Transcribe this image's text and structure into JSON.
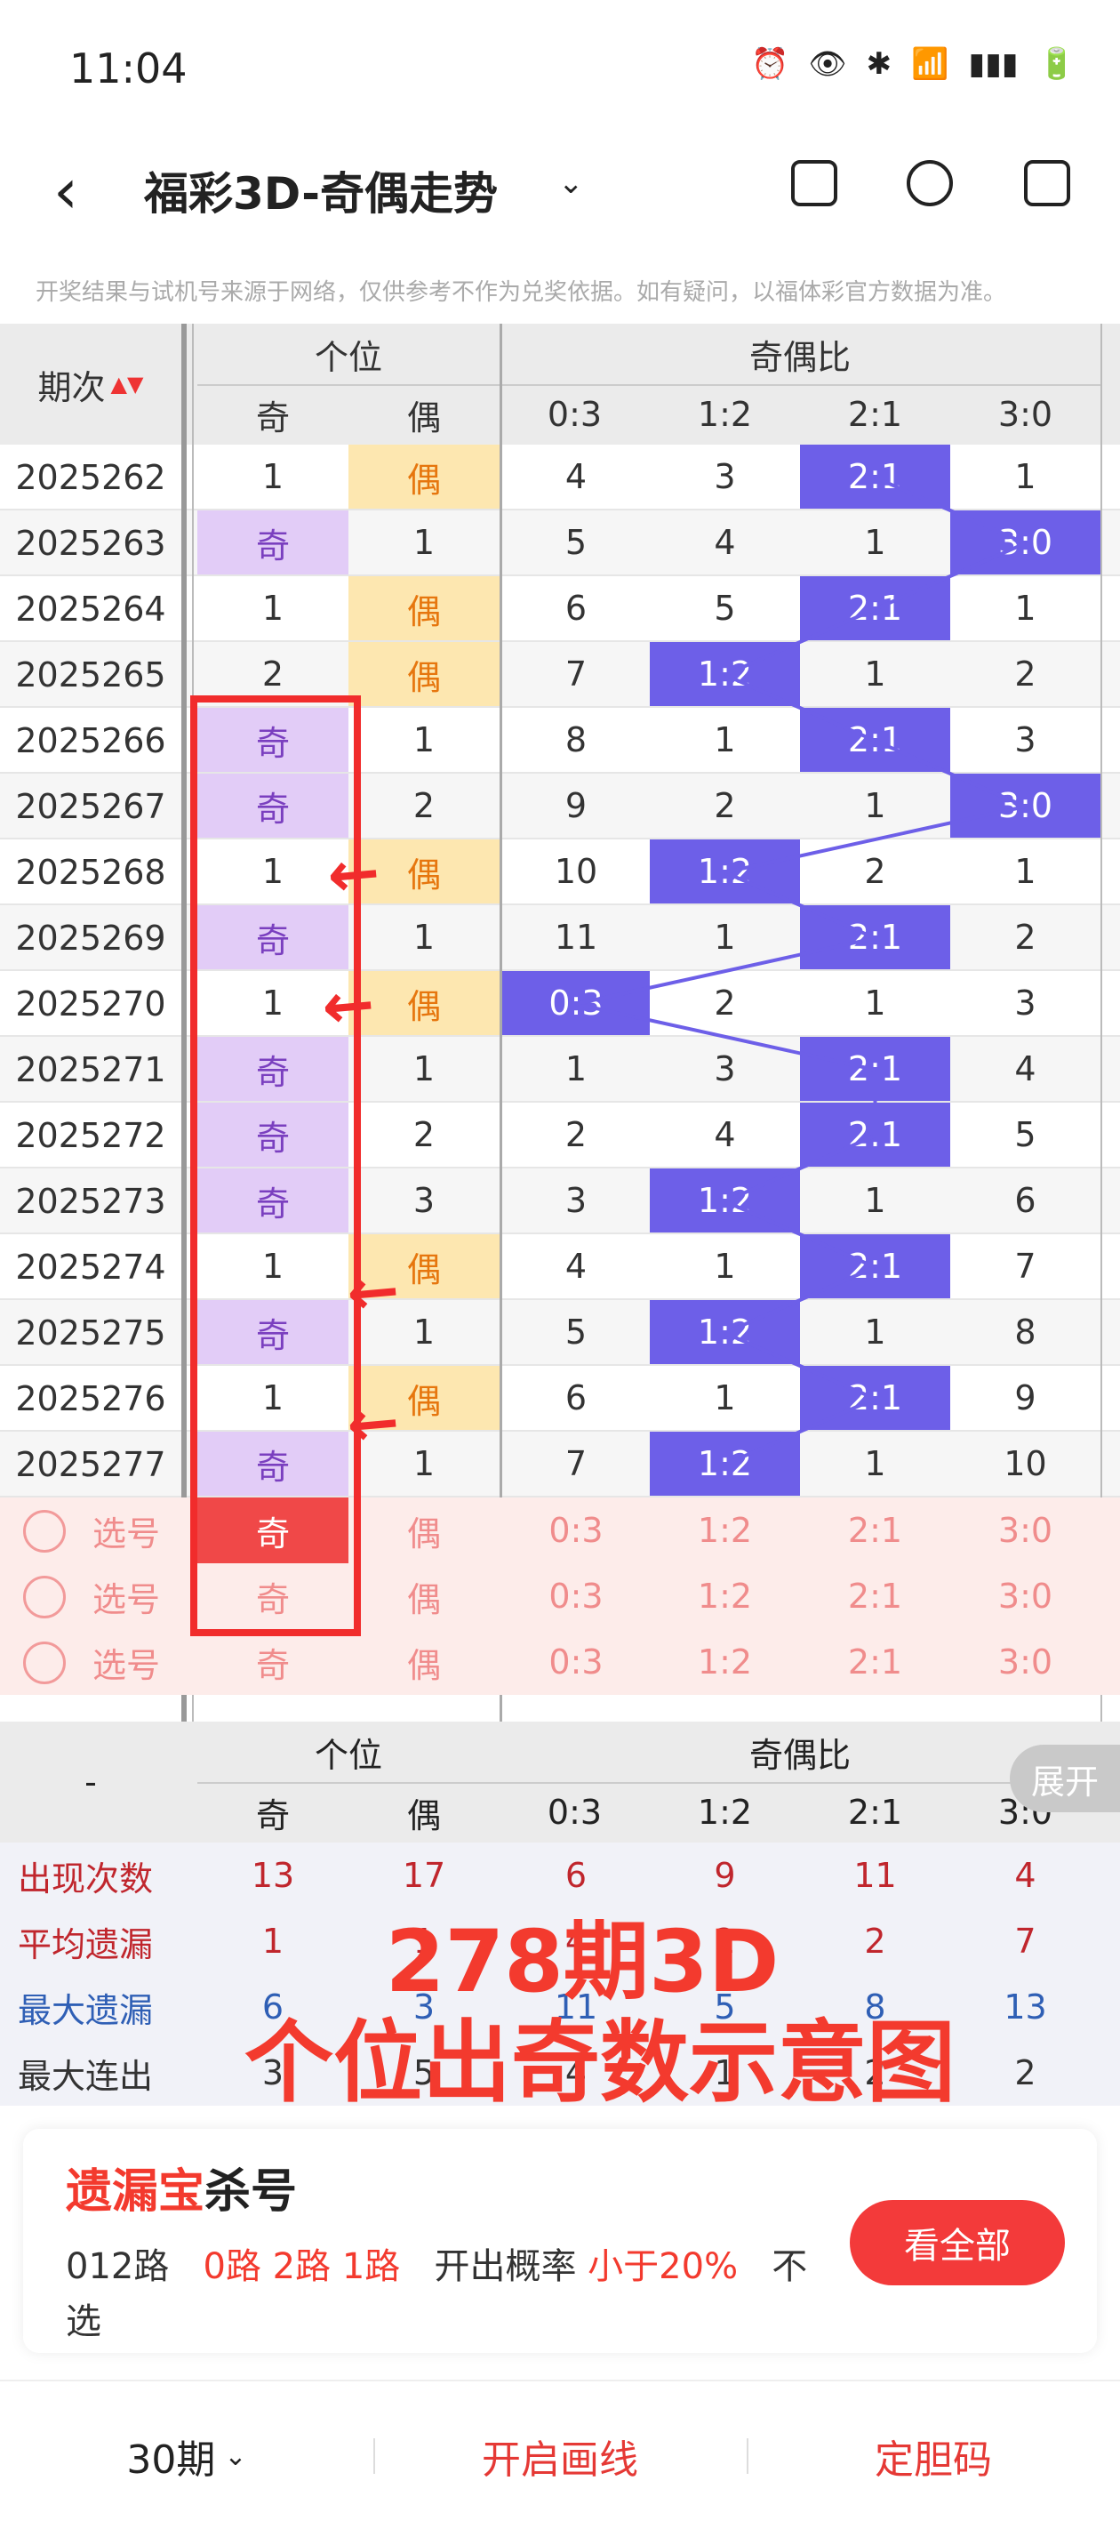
{
  "status": {
    "time": "11:04",
    "battery_icon": "battery-charging-icon"
  },
  "header": {
    "title": "福彩3D-奇偶走势"
  },
  "notice": "开奖结果与试机号来源于网络，仅供参考不作为兑奖依据。如有疑问，以福体彩官方数据为准。",
  "table": {
    "period_header": "期次",
    "group_units": "个位",
    "group_ratio": "奇偶比",
    "col_odd": "奇",
    "col_even": "偶",
    "col_03": "0:3",
    "col_12": "1:2",
    "col_21": "2:1",
    "col_30": "3:0",
    "rows": [
      {
        "period": "2025262",
        "odd": "1",
        "even": "偶",
        "r03": "4",
        "r12": "3",
        "r21": "2:1",
        "r30": "1",
        "hit": "21",
        "unit": "even"
      },
      {
        "period": "2025263",
        "odd": "奇",
        "even": "1",
        "r03": "5",
        "r12": "4",
        "r21": "1",
        "r30": "3:0",
        "hit": "30",
        "unit": "odd"
      },
      {
        "period": "2025264",
        "odd": "1",
        "even": "偶",
        "r03": "6",
        "r12": "5",
        "r21": "2:1",
        "r30": "1",
        "hit": "21",
        "unit": "even"
      },
      {
        "period": "2025265",
        "odd": "2",
        "even": "偶",
        "r03": "7",
        "r12": "1:2",
        "r21": "1",
        "r30": "2",
        "hit": "12",
        "unit": "even"
      },
      {
        "period": "2025266",
        "odd": "奇",
        "even": "1",
        "r03": "8",
        "r12": "1",
        "r21": "2:1",
        "r30": "3",
        "hit": "21",
        "unit": "odd"
      },
      {
        "period": "2025267",
        "odd": "奇",
        "even": "2",
        "r03": "9",
        "r12": "2",
        "r21": "1",
        "r30": "3:0",
        "hit": "30",
        "unit": "odd"
      },
      {
        "period": "2025268",
        "odd": "1",
        "even": "偶",
        "r03": "10",
        "r12": "1:2",
        "r21": "2",
        "r30": "1",
        "hit": "12",
        "unit": "even"
      },
      {
        "period": "2025269",
        "odd": "奇",
        "even": "1",
        "r03": "11",
        "r12": "1",
        "r21": "2:1",
        "r30": "2",
        "hit": "21",
        "unit": "odd"
      },
      {
        "period": "2025270",
        "odd": "1",
        "even": "偶",
        "r03": "0:3",
        "r12": "2",
        "r21": "1",
        "r30": "3",
        "hit": "03",
        "unit": "even"
      },
      {
        "period": "2025271",
        "odd": "奇",
        "even": "1",
        "r03": "1",
        "r12": "3",
        "r21": "2:1",
        "r30": "4",
        "hit": "21",
        "unit": "odd"
      },
      {
        "period": "2025272",
        "odd": "奇",
        "even": "2",
        "r03": "2",
        "r12": "4",
        "r21": "2:1",
        "r30": "5",
        "hit": "21",
        "unit": "odd"
      },
      {
        "period": "2025273",
        "odd": "奇",
        "even": "3",
        "r03": "3",
        "r12": "1:2",
        "r21": "1",
        "r30": "6",
        "hit": "12",
        "unit": "odd"
      },
      {
        "period": "2025274",
        "odd": "1",
        "even": "偶",
        "r03": "4",
        "r12": "1",
        "r21": "2:1",
        "r30": "7",
        "hit": "21",
        "unit": "even"
      },
      {
        "period": "2025275",
        "odd": "奇",
        "even": "1",
        "r03": "5",
        "r12": "1:2",
        "r21": "1",
        "r30": "8",
        "hit": "12",
        "unit": "odd"
      },
      {
        "period": "2025276",
        "odd": "1",
        "even": "偶",
        "r03": "6",
        "r12": "1",
        "r21": "2:1",
        "r30": "9",
        "hit": "21",
        "unit": "even"
      },
      {
        "period": "2025277",
        "odd": "奇",
        "even": "1",
        "r03": "7",
        "r12": "1:2",
        "r21": "1",
        "r30": "10",
        "hit": "12",
        "unit": "odd"
      }
    ],
    "select_label": "选号",
    "stats_dash": "-",
    "stats": [
      {
        "label": "出现次数",
        "values": [
          "13",
          "17",
          "6",
          "9",
          "11",
          "4"
        ],
        "color": "#c0262d"
      },
      {
        "label": "平均遗漏",
        "values": [
          "1",
          "1",
          "4",
          "2",
          "2",
          "7"
        ],
        "color": "#c0262d"
      },
      {
        "label": "最大遗漏",
        "values": [
          "6",
          "3",
          "11",
          "5",
          "8",
          "13"
        ],
        "color": "#2f5fb5"
      },
      {
        "label": "最大连出",
        "values": [
          "3",
          "5",
          "4",
          "1",
          "2",
          "2"
        ],
        "color": "#333333"
      }
    ],
    "expand_label": "展开"
  },
  "overlay": {
    "line1": "278期3D",
    "line2": "个位出奇数示意图"
  },
  "card": {
    "title_red": "遗漏宝",
    "title_black": "杀号",
    "route_label": "012路",
    "routes": "0路 2路 1路",
    "prob_label": "开出概率",
    "prob_value": "小于20%",
    "tail1": "不",
    "tail2": "选",
    "button": "看全部"
  },
  "bottom": {
    "periods": "30期",
    "draw_lines": "开启画线",
    "fix_code": "定胆码"
  },
  "colors": {
    "accent": "#f33a2e",
    "blue": "#6d5fe8",
    "purple": "#e2ccf7",
    "yellow": "#fde7b0"
  }
}
